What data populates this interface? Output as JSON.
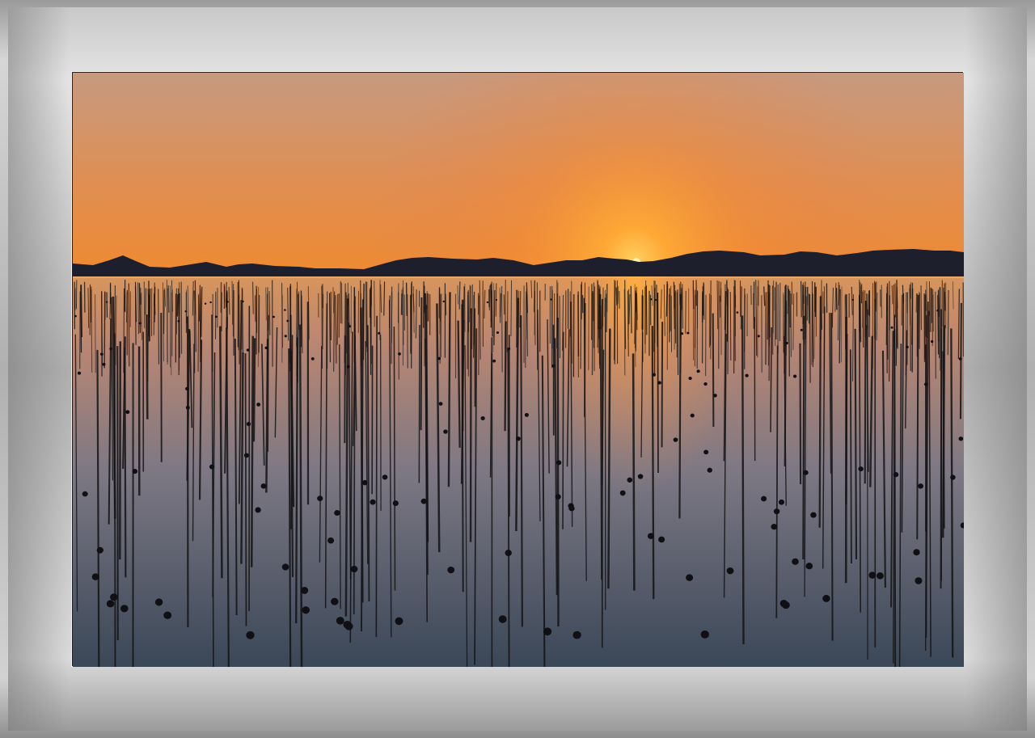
{
  "scene": {
    "subject": "sunset-over-seaweed-farm",
    "colors": {
      "sky_top": "#c9977a",
      "sky_mid": "#e9944a",
      "sun_glow": "#ffb040",
      "horizon": "#f08a2a",
      "mountains": "#1e1f2c",
      "water_top": "#e39a55",
      "water_mid": "#8d7f80",
      "water_bottom": "#3f4d5e",
      "poles": "#141416"
    }
  }
}
